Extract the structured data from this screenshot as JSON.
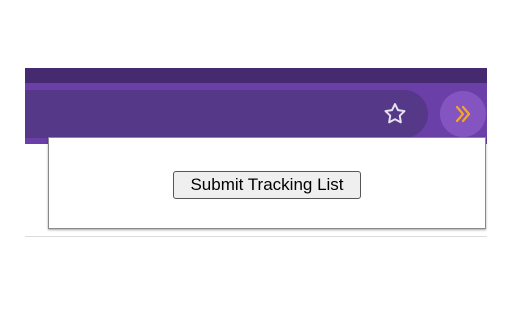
{
  "toolbar": {
    "star_icon": "star-outline-icon",
    "extension_icon": "double-chevron-right-icon"
  },
  "popup": {
    "submit_label": "Submit Tracking List"
  },
  "colors": {
    "top_strip": "#452a70",
    "toolbar": "#6b3fa8",
    "address_bar": "#563888",
    "extension_button": "#8455c0",
    "extension_icon": "#f5a623",
    "star_icon": "#e7e2f0"
  }
}
